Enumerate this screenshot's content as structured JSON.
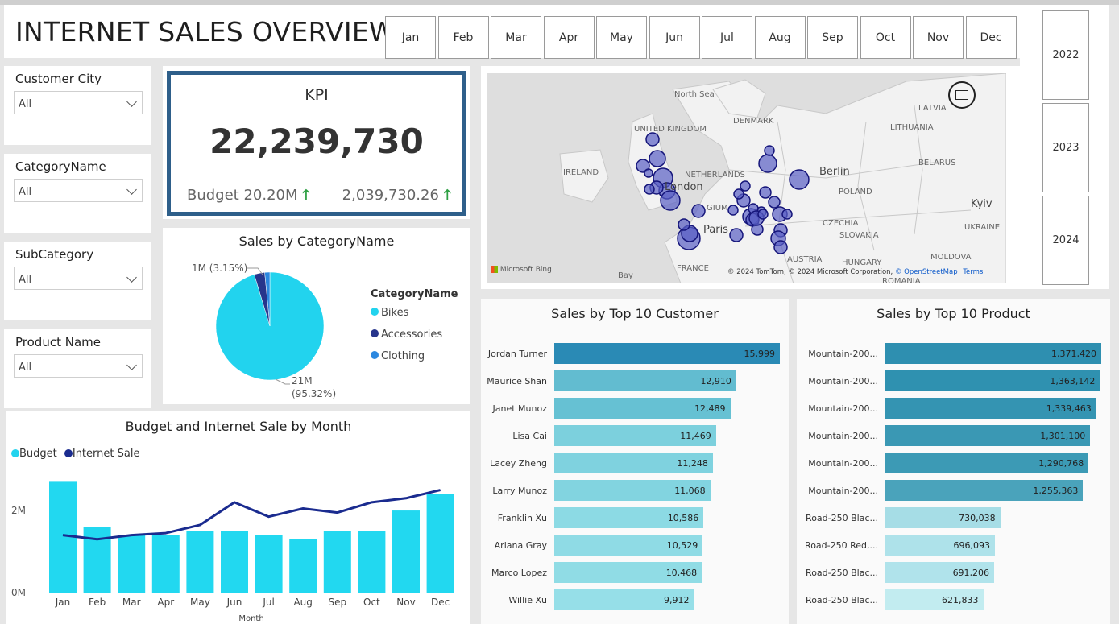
{
  "header": {
    "title": "INTERNET SALES OVERVIEW"
  },
  "months": [
    "Jan",
    "Feb",
    "Mar",
    "Apr",
    "May",
    "Jun",
    "Jul",
    "Aug",
    "Sep",
    "Oct",
    "Nov",
    "Dec"
  ],
  "years": [
    "2022",
    "2023",
    "2024"
  ],
  "slicers": [
    {
      "label": "Customer City",
      "value": "All"
    },
    {
      "label": "CategoryName",
      "value": "All"
    },
    {
      "label": "SubCategory",
      "value": "All"
    },
    {
      "label": "Product Name",
      "value": "All"
    }
  ],
  "kpi": {
    "title": "KPI",
    "value": "22,239,730",
    "budget": "Budget 20.20M",
    "diff": "2,039,730.26",
    "arrow": "🡑"
  },
  "pie": {
    "title": "Sales by CategoryName",
    "legend_title": "CategoryName",
    "label_small": "1M (3.15%)",
    "label_big_1": "21M",
    "label_big_2": "(95.32%)",
    "colors": {
      "Bikes": "#22d3ee",
      "Accessories": "#27358c",
      "Clothing": "#2b88e0"
    }
  },
  "map": {
    "labels": [
      "North Sea",
      "DENMARK",
      "LATVIA",
      "LITHUANIA",
      "UNITED KINGDOM",
      "IRELAND",
      "NETHERLANDS",
      "Berlin",
      "BELARUS",
      "POLAND",
      "London",
      "GIUM",
      "Kyiv",
      "CZECHIA",
      "UKRAINE",
      "Paris",
      "SLOVAKIA",
      "MOLDOVA",
      "AUSTRIA",
      "HUNGARY",
      "FRANCE",
      "Bay",
      "ROMANIA"
    ],
    "brand": "Microsoft Bing",
    "copyright": "© 2024 TomTom, © 2024 Microsoft Corporation,",
    "osm": "© OpenStreetMap",
    "terms": "Terms"
  },
  "customers": {
    "title": "Sales by Top 10 Customer",
    "names": [
      "Jordan Turner",
      "Maurice Shan",
      "Janet Munoz",
      "Lisa Cai",
      "Lacey Zheng",
      "Larry Munoz",
      "Franklin Xu",
      "Ariana Gray",
      "Marco Lopez",
      "Willie Xu"
    ],
    "labels": [
      "15,999",
      "12,910",
      "12,489",
      "11,469",
      "11,248",
      "11,068",
      "10,586",
      "10,529",
      "10,468",
      "9,912"
    ]
  },
  "products": {
    "title": "Sales by Top 10 Product",
    "names": [
      "Mountain-200...",
      "Mountain-200...",
      "Mountain-200...",
      "Mountain-200...",
      "Mountain-200...",
      "Mountain-200...",
      "Road-250 Blac...",
      "Road-250 Red,...",
      "Road-250 Blac...",
      "Road-250 Blac..."
    ],
    "labels": [
      "1,371,420",
      "1,363,142",
      "1,339,463",
      "1,301,100",
      "1,290,768",
      "1,255,363",
      "730,038",
      "696,093",
      "691,206",
      "621,833"
    ]
  },
  "monthly": {
    "title": "Budget and Internet Sale by Month",
    "legend": [
      "Budget",
      "Internet Sale"
    ],
    "xlabel": "Month",
    "yticks": [
      "2M",
      "0M"
    ]
  },
  "chart_data": [
    {
      "type": "pie",
      "title": "Sales by CategoryName",
      "categories": [
        "Bikes",
        "Accessories",
        "Clothing"
      ],
      "values": [
        95.32,
        3.15,
        1.53
      ],
      "legend_title": "CategoryName"
    },
    {
      "type": "bar",
      "title": "Sales by Top 10 Customer",
      "categories": [
        "Jordan Turner",
        "Maurice Shan",
        "Janet Munoz",
        "Lisa Cai",
        "Lacey Zheng",
        "Larry Munoz",
        "Franklin Xu",
        "Ariana Gray",
        "Marco Lopez",
        "Willie Xu"
      ],
      "values": [
        15999,
        12910,
        12489,
        11469,
        11248,
        11068,
        10586,
        10529,
        10468,
        9912
      ]
    },
    {
      "type": "bar",
      "title": "Sales by Top 10 Product",
      "categories": [
        "Mountain-200...",
        "Mountain-200...",
        "Mountain-200...",
        "Mountain-200...",
        "Mountain-200...",
        "Mountain-200...",
        "Road-250 Blac...",
        "Road-250 Red,...",
        "Road-250 Blac...",
        "Road-250 Blac..."
      ],
      "values": [
        1371420,
        1363142,
        1339463,
        1301100,
        1290768,
        1255363,
        730038,
        696093,
        691206,
        621833
      ]
    },
    {
      "type": "bar",
      "title": "Budget and Internet Sale by Month",
      "xlabel": "Month",
      "categories": [
        "Jan",
        "Feb",
        "Mar",
        "Apr",
        "May",
        "Jun",
        "Jul",
        "Aug",
        "Sep",
        "Oct",
        "Nov",
        "Dec"
      ],
      "series": [
        {
          "name": "Budget",
          "type": "bar",
          "values": [
            2.7,
            1.6,
            1.4,
            1.4,
            1.5,
            1.5,
            1.4,
            1.3,
            1.5,
            1.5,
            2.0,
            2.4
          ]
        },
        {
          "name": "Internet Sale",
          "type": "line",
          "values": [
            1.4,
            1.3,
            1.4,
            1.45,
            1.65,
            2.2,
            1.85,
            2.05,
            1.95,
            2.2,
            2.3,
            2.5
          ]
        }
      ],
      "ylim": [
        0,
        3.1
      ],
      "yticks": [
        "0M",
        "2M"
      ]
    }
  ]
}
